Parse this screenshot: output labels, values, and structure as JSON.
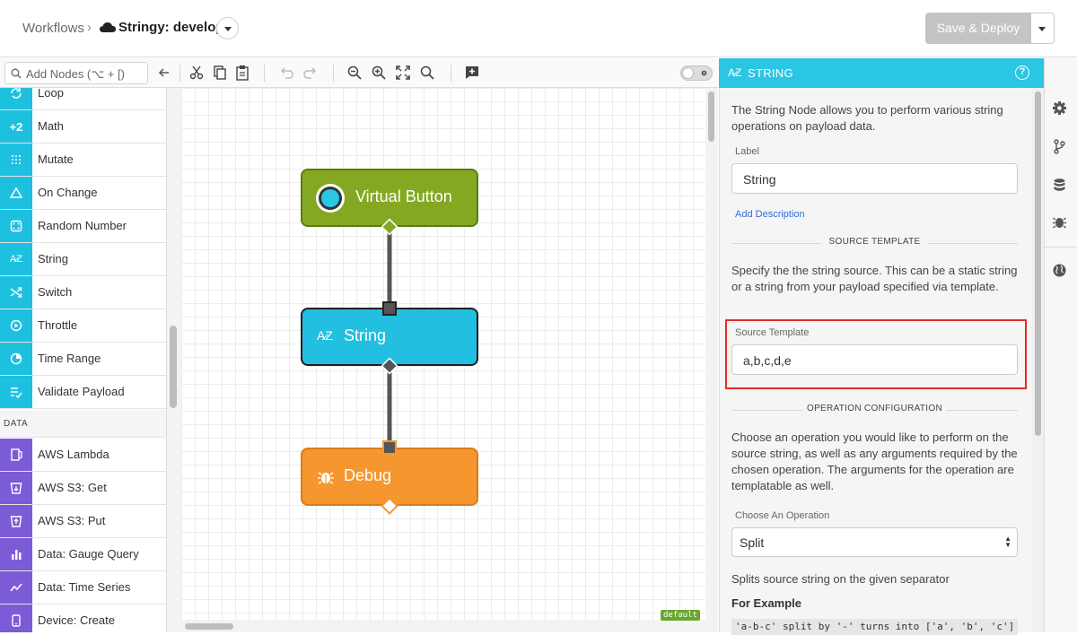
{
  "header": {
    "breadcrumb_root": "Workflows",
    "breadcrumb_sep": "›",
    "workflow_name": "Stringy: develop",
    "save_label": "Save & Deploy"
  },
  "toolbar": {
    "search_placeholder": "Add Nodes (⌥ + [)"
  },
  "palette": {
    "items_top": [
      {
        "label": "Loop",
        "icon": "loop-icon",
        "color": "#1ec0e0"
      },
      {
        "label": "Math",
        "icon": "math-icon",
        "color": "#1ec0e0",
        "glyph": "+2"
      },
      {
        "label": "Mutate",
        "icon": "mutate-icon",
        "color": "#1ec0e0"
      },
      {
        "label": "On Change",
        "icon": "triangle-icon",
        "color": "#1ec0e0"
      },
      {
        "label": "Random Number",
        "icon": "dice-icon",
        "color": "#1ec0e0"
      },
      {
        "label": "String",
        "icon": "az-icon",
        "color": "#1ec0e0",
        "glyph": "A̷Z"
      },
      {
        "label": "Switch",
        "icon": "shuffle-icon",
        "color": "#1ec0e0"
      },
      {
        "label": "Throttle",
        "icon": "throttle-icon",
        "color": "#1ec0e0"
      },
      {
        "label": "Time Range",
        "icon": "clock-icon",
        "color": "#1ec0e0"
      },
      {
        "label": "Validate Payload",
        "icon": "checklist-icon",
        "color": "#1ec0e0"
      }
    ],
    "category": "DATA",
    "items_data": [
      {
        "label": "AWS Lambda",
        "icon": "lambda-icon",
        "color": "#7b5bd6"
      },
      {
        "label": "AWS S3: Get",
        "icon": "bucket-icon",
        "color": "#7b5bd6"
      },
      {
        "label": "AWS S3: Put",
        "icon": "bucket-icon",
        "color": "#7b5bd6"
      },
      {
        "label": "Data: Gauge Query",
        "icon": "bar-chart-icon",
        "color": "#7b5bd6"
      },
      {
        "label": "Data: Time Series",
        "icon": "line-chart-icon",
        "color": "#7b5bd6"
      },
      {
        "label": "Device: Create",
        "icon": "device-icon",
        "color": "#7b5bd6"
      }
    ]
  },
  "canvas": {
    "nodes": {
      "virtual_button": "Virtual Button",
      "string": "String",
      "debug": "Debug"
    },
    "tag": "default",
    "colors": {
      "trigger": "#85a823",
      "logic": "#22bfe0",
      "output": "#f6962e"
    }
  },
  "panel": {
    "header_glyph": "A̷Z",
    "title": "STRING",
    "intro": "The String Node allows you to perform various string operations on payload data.",
    "label_caption": "Label",
    "label_value": "String",
    "add_description": "Add Description",
    "section_source": "SOURCE TEMPLATE",
    "source_help": "Specify the the string source. This can be a static string or a string from your payload specified via template.",
    "source_caption": "Source Template",
    "source_value": "a,b,c,d,e",
    "section_operation": "OPERATION CONFIGURATION",
    "operation_help": "Choose an operation you would like to perform on the source string, as well as any arguments required by the chosen operation. The arguments for the operation are templatable as well.",
    "operation_caption": "Choose An Operation",
    "operation_value": "Split",
    "operation_desc": "Splits source string on the given separator",
    "example_title": "For Example",
    "example_code": "'a-b-c' split by '-' turns into ['a', 'b', 'c']"
  }
}
